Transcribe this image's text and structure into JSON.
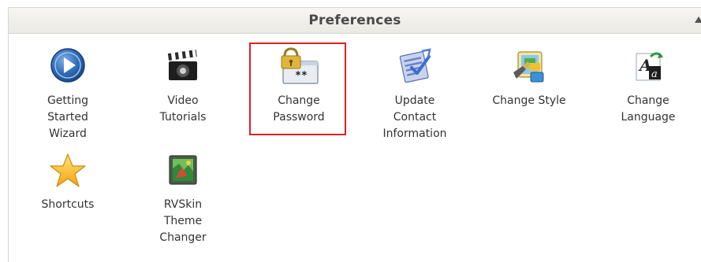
{
  "panel": {
    "title": "Preferences"
  },
  "items": [
    {
      "label": "Getting\nStarted\nWizard",
      "icon": "play-circle-icon"
    },
    {
      "label": "Video\nTutorials",
      "icon": "clapperboard-icon"
    },
    {
      "label": "Change\nPassword",
      "icon": "lock-password-icon"
    },
    {
      "label": "Update\nContact\nInformation",
      "icon": "contact-update-icon"
    },
    {
      "label": "Change Style",
      "icon": "palette-icon"
    },
    {
      "label": "Change\nLanguage",
      "icon": "language-icon"
    },
    {
      "label": "Shortcuts",
      "icon": "star-icon"
    },
    {
      "label": "RVSkin\nTheme\nChanger",
      "icon": "theme-changer-icon"
    }
  ],
  "highlight_color": "#e02020"
}
